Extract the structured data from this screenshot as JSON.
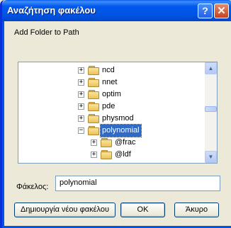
{
  "window": {
    "title": "Αναζήτηση φακέλου",
    "help_label": "?",
    "close_label": "✕"
  },
  "description": "Add Folder to Path",
  "tree": {
    "items": [
      {
        "label": "ncd",
        "expander": "+",
        "selected": false
      },
      {
        "label": "nnet",
        "expander": "+",
        "selected": false
      },
      {
        "label": "optim",
        "expander": "+",
        "selected": false
      },
      {
        "label": "pde",
        "expander": "+",
        "selected": false
      },
      {
        "label": "physmod",
        "expander": "+",
        "selected": false
      },
      {
        "label": "polynomial",
        "expander": "−",
        "selected": true
      },
      {
        "label": "@frac",
        "expander": "+",
        "selected": false
      },
      {
        "label": "@ldf",
        "expander": "+",
        "selected": false
      }
    ],
    "scroll_up": "▲",
    "scroll_down": "▼"
  },
  "folder_field": {
    "label": "Φάκελος:",
    "value": "polynomial"
  },
  "buttons": {
    "new_folder": "Δημιουργία νέου φακέλου",
    "ok": "OK",
    "cancel": "Άκυρο"
  }
}
